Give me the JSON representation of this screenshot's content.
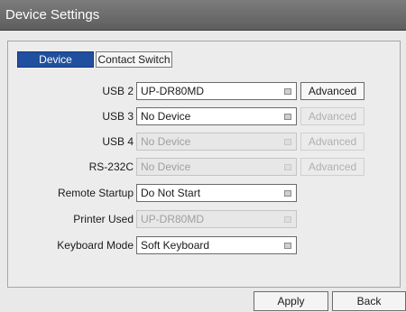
{
  "window": {
    "title": "Device Settings"
  },
  "tabs": [
    {
      "label": "Device",
      "active": true
    },
    {
      "label": "Contact Switch",
      "active": false
    }
  ],
  "settings": [
    {
      "label": "USB 2",
      "value": "UP-DR80MD",
      "enabled": true,
      "advanced": "Advanced",
      "advanced_enabled": true
    },
    {
      "label": "USB 3",
      "value": "No Device",
      "enabled": true,
      "advanced": "Advanced",
      "advanced_enabled": false
    },
    {
      "label": "USB 4",
      "value": "No Device",
      "enabled": false,
      "advanced": "Advanced",
      "advanced_enabled": false
    },
    {
      "label": "RS-232C",
      "value": "No Device",
      "enabled": false,
      "advanced": "Advanced",
      "advanced_enabled": false
    },
    {
      "label": "Remote Startup",
      "value": "Do Not Start",
      "enabled": true
    },
    {
      "label": "Printer Used",
      "value": "UP-DR80MD",
      "enabled": false
    },
    {
      "label": "Keyboard Mode",
      "value": "Soft Keyboard",
      "enabled": true
    }
  ],
  "buttons": {
    "apply": "Apply",
    "back": "Back"
  },
  "colors": {
    "title_bar": "#6b6b6b",
    "active_tab": "#1f4f9e",
    "background": "#e9e9e9"
  }
}
